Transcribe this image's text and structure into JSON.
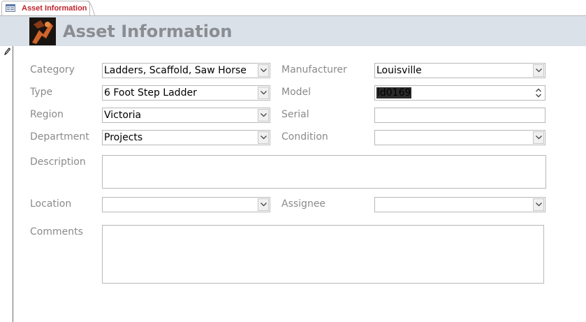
{
  "tab": {
    "label": "Asset Information"
  },
  "header": {
    "title": "Asset Information"
  },
  "form": {
    "category": {
      "label": "Category",
      "value": "Ladders, Scaffold, Saw Horse"
    },
    "type": {
      "label": "Type",
      "value": "6 Foot Step Ladder"
    },
    "region": {
      "label": "Region",
      "value": "Victoria"
    },
    "department": {
      "label": "Department",
      "value": "Projects"
    },
    "manufacturer": {
      "label": "Manufacturer",
      "value": "Louisville"
    },
    "model": {
      "label": "Model",
      "value": "ld0169"
    },
    "serial": {
      "label": "Serial",
      "value": ""
    },
    "condition": {
      "label": "Condition",
      "value": ""
    },
    "description": {
      "label": "Description",
      "value": ""
    },
    "location": {
      "label": "Location",
      "value": ""
    },
    "assignee": {
      "label": "Assignee",
      "value": ""
    },
    "comments": {
      "label": "Comments",
      "value": ""
    }
  },
  "colors": {
    "tab_text": "#c0242c",
    "header_bg": "#dbe1e9",
    "title_text": "#8a8d91",
    "label_text": "#8a8a8a"
  },
  "icons": {
    "tab": "form-icon",
    "logo": "asset-logo-icon",
    "record": "pencil-icon"
  }
}
